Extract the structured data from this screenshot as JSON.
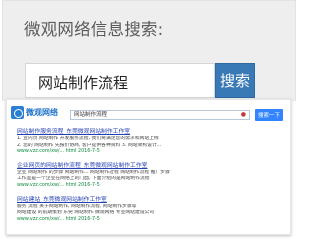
{
  "header": {
    "title": "微观网络信息搜索:",
    "search_value": "网站制作流程",
    "search_button": "搜索"
  },
  "embedded": {
    "logo_text": "微观网络",
    "search_value": "网站制作流程",
    "search_button": "搜索一下",
    "results": [
      {
        "title": "网站制作服务流程_东莞微观网站制作工作室",
        "snippet_1": "1. 宣内页 网站制作 开发服务流程, 我们将满足您的需求和网站上线",
        "snippet_2": "2. 您的 网站制作 先报价协商, 客户提供各种资料 3. 网站架构设计...",
        "url": "www.vzz.com/xw/... html 2016-7-5"
      },
      {
        "title": "企业网页的网站制作流程_东莞微观网站制作工作室",
        "snippet_1": "企业 网站制作 的步骤 网站制作... 网站制作过程 网站制作流程 推广步骤",
        "snippet_2": "工作室是一个企业在网络上的门面, 下面介绍的是网站制作流程",
        "url": "www.vzz.com/xw/... html 2016-7-5"
      },
      {
        "title": "网站建站_东莞微观网站制作工作室",
        "snippet_1": "服务 流程 关于网站制作, 网站制作流程, 网站制作步骤等",
        "snippet_2": "网站建设 的前期策划 东莞 网站制作 微观网络 专业网站建设公司",
        "url": "www.vzz.com/xw/... html 2016-7-5"
      }
    ]
  },
  "colors": {
    "panel_bg": "#eeeeee",
    "button_blue": "#3979b6",
    "link_blue": "#2440b3",
    "url_green": "#0a8a3a"
  },
  "icons": [
    "logo-mark-icon",
    "location-pin-icon"
  ]
}
